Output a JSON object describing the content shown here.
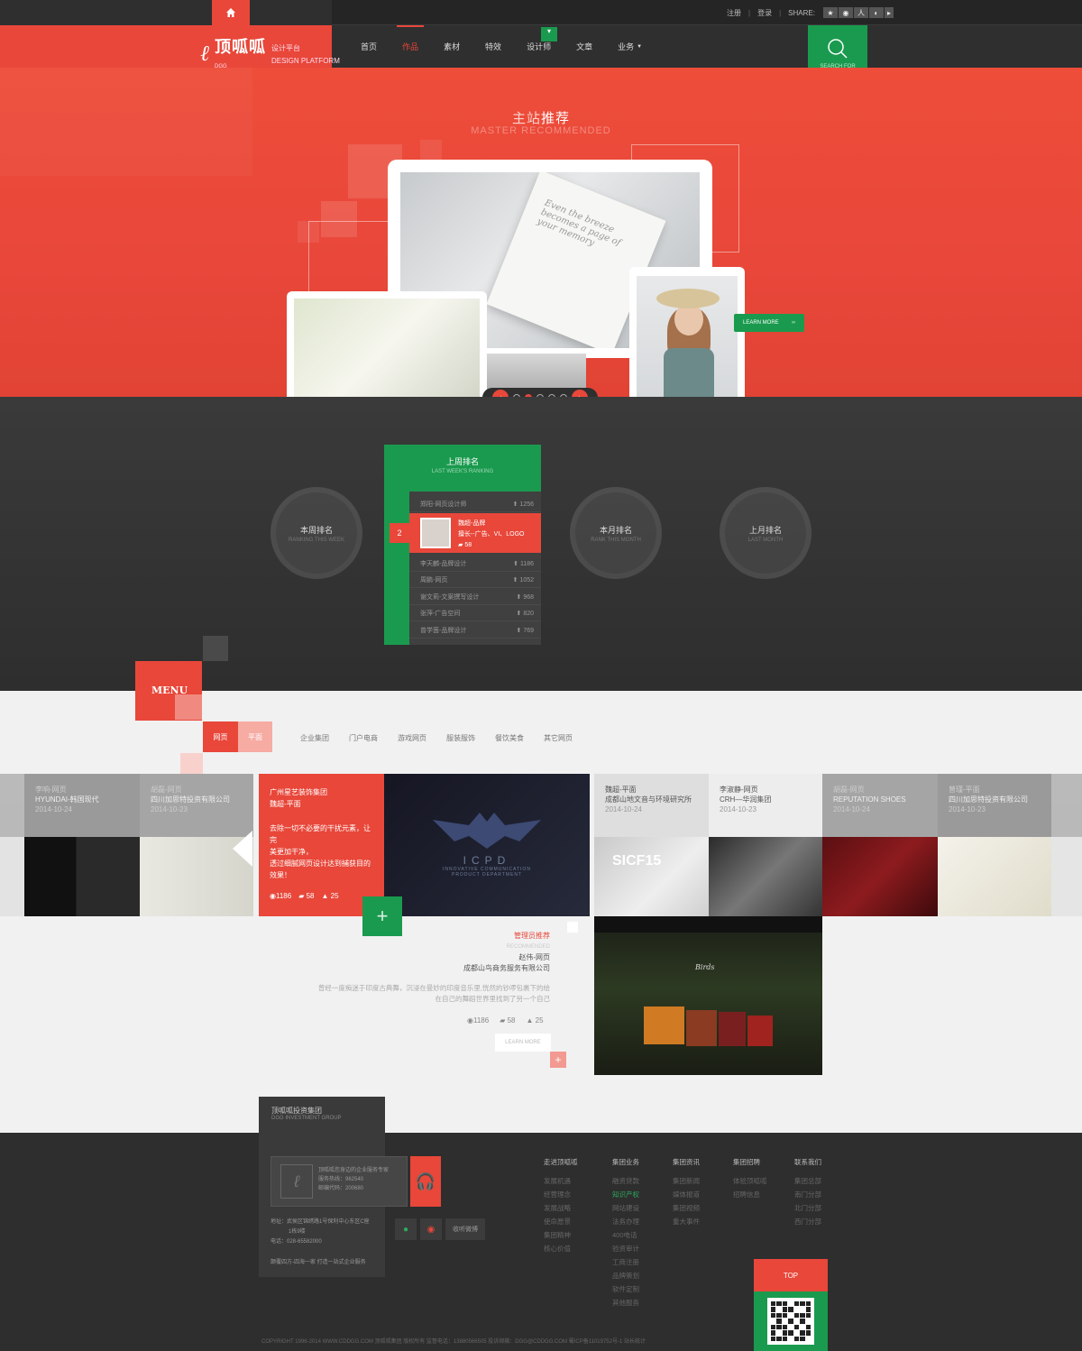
{
  "header": {
    "brand_cn": "顶呱呱",
    "brand_sub_cn": "设计平台",
    "brand_sub_en": "DESIGN PLATFORM",
    "brand_small": "DGG",
    "nav": [
      {
        "label": "首页",
        "active": false
      },
      {
        "label": "作品",
        "active": true
      },
      {
        "label": "素材",
        "active": false
      },
      {
        "label": "特效",
        "active": false
      },
      {
        "label": "设计师",
        "active": false
      },
      {
        "label": "文章",
        "active": false
      },
      {
        "label": "业务",
        "active": false
      }
    ],
    "register": "注册",
    "login": "登录",
    "share_label": "SHARE:",
    "search_label": "SEARCH FOR"
  },
  "hero": {
    "title_a": "主站",
    "title_b": "推荐",
    "subtitle": "MASTER RECOMMENDED",
    "paper_text": "Even the breeze becomes a page of your memory",
    "learn_more": "LEARN MORE",
    "slides": 5,
    "active_slide": 2
  },
  "ranking": {
    "circles": [
      {
        "cn": "本周排名",
        "en": "RANKING THIS WEEK"
      },
      {
        "cn": "本月排名",
        "en": "RANK THIS MONTH"
      },
      {
        "cn": "上月排名",
        "en": "LAST MONTH"
      }
    ],
    "panel_title": "上周排名",
    "panel_sub": "LAST WEEK'S RANKING",
    "rank_number": "2",
    "top_row": {
      "name": "郑阳-网页设计师",
      "count": "1256"
    },
    "highlight": {
      "name": "魏超-品牌",
      "desc": "擅长--广告、VI、LOGO",
      "count": "58"
    },
    "rows": [
      {
        "name": "李天麟-品牌设计",
        "count": "1186"
      },
      {
        "name": "周鹏-网页",
        "count": "1052"
      },
      {
        "name": "谢文莉-文案撰写设计",
        "count": "968"
      },
      {
        "name": "张萍-广告空间",
        "count": "820"
      },
      {
        "name": "曾学茵-品牌设计",
        "count": "769"
      }
    ]
  },
  "menu": {
    "label": "MENU",
    "tab_web": "网页",
    "tab_flat": "平面",
    "cats": [
      "企业集团",
      "门户电商",
      "游戏网页",
      "服装服饰",
      "餐饮美食",
      "其它网页"
    ]
  },
  "gallery": {
    "left": [
      {
        "name": "李响-网页",
        "title": "HYUNDAI-韩国现代",
        "date": "2014-10-24"
      },
      {
        "name": "胡磊-网页",
        "title": "四川加思特投资有限公司",
        "date": "2014-10-23"
      }
    ],
    "featured": {
      "company": "广州星艺装饰集团",
      "author": "魏超-平面",
      "desc1": "去除一切不必要的干扰元素，让完",
      "desc2": "美更加干净，",
      "desc3": "透过细腻网页设计达到捕获目的",
      "desc4": "效果！",
      "views": "1186",
      "comments": "58",
      "likes": "25",
      "logo_text": "ICPD",
      "logo_sub1": "INNOVATIVE COMMUNICATION",
      "logo_sub2": "PRODUCT DEPARTMENT"
    },
    "right": [
      {
        "name": "魏超-平面",
        "title": "成都山地文音与环境研究所",
        "date": "2014-10-24"
      },
      {
        "name": "李淑静-网页",
        "title": "CRH—华润集团",
        "date": "2014-10-23"
      },
      {
        "name": "胡磊-网页",
        "title": "REPUTATION SHOES",
        "date": "2014-10-24"
      },
      {
        "name": "曾瑾-平面",
        "title": "四川加思特投资有限公司",
        "date": "2014-10-23"
      }
    ],
    "card_img_text": "SICF15"
  },
  "admin": {
    "title": "管理员推荐",
    "title_en": "RECOMMENDED",
    "author": "赵伟-网页",
    "company": "成都山鸟商务服务有限公司",
    "body1": "曾经一度痴迷于印度古典舞，沉浸在曼妙的印度音乐里,恍然的钞啰包裹下的绘",
    "body2": "在自己的舞蹈世界里找到了另一个自己",
    "views": "1186",
    "comments": "58",
    "likes": "25",
    "learn_more": "LEARN MORE",
    "shot_title": "Birds"
  },
  "footer": {
    "company_cn": "顶呱呱投资集团",
    "company_en": "DGG INVESTMENT GROUP",
    "card_line1": "顶呱呱您身边的企业服务专家",
    "card_line2": "服务热线：962540",
    "card_line3": "邮编代码：200680",
    "addr1": "地址：武侯区锦绣路1号保利中心东区C座",
    "addr2": "1栋9楼",
    "tel": "电话：028-65582000",
    "slogan": "颠覆四方-四海一家 打造一站式企业服务",
    "weibo": "收听微博",
    "cols": [
      {
        "h": "走进顶呱呱",
        "items": [
          "发展机遇",
          "经营理念",
          "发展战略",
          "使命愿景",
          "集团精神",
          "核心价值"
        ]
      },
      {
        "h": "集团业务",
        "items": [
          "融资贷款",
          "知识产权",
          "网站建设",
          "法务办理",
          "400电话",
          "验资审计",
          "工商注册",
          "品牌策划",
          "软件定制",
          "其他服务"
        ]
      },
      {
        "h": "集团资讯",
        "items": [
          "集团新闻",
          "媒体报道",
          "集团视频",
          "重大事件"
        ]
      },
      {
        "h": "集团招聘",
        "items": [
          "体验顶呱呱",
          "招聘信息"
        ]
      },
      {
        "h": "联系我们",
        "items": [
          "集团总部",
          "南门分部",
          "北门分部",
          "西门分部"
        ]
      }
    ],
    "copyright": "COPYRIGHT 1996-2014 WWW.CDDGG.COM 顶呱呱集团 版权所有 监督电话：13880566505 投诉邮箱：DGG@CDDGG.COM 蜀ICP备11019752号-1 站长统计",
    "top": "TOP"
  },
  "colors": {
    "accent": "#e8473a",
    "green": "#1a9a4e",
    "dark": "#2f2f2f"
  }
}
